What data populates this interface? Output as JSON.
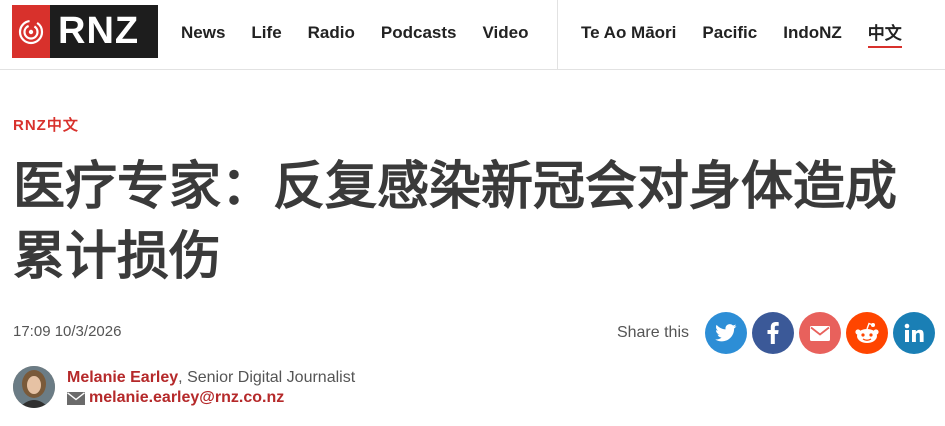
{
  "brand": {
    "name": "RNZ",
    "accent": "#d8312c"
  },
  "nav": {
    "primary": [
      "News",
      "Life",
      "Radio",
      "Podcasts",
      "Video"
    ],
    "secondary": [
      "Te Ao Māori",
      "Pacific",
      "IndoNZ",
      "中文"
    ]
  },
  "article": {
    "section": "RNZ中文",
    "headline": "医疗专家：反复感染新冠会对身体造成累计损伤",
    "timestamp": "17:09 10/3/2026"
  },
  "share": {
    "label": "Share this",
    "buttons": [
      {
        "name": "twitter-icon",
        "color": "#2d8ed6"
      },
      {
        "name": "facebook-icon",
        "color": "#3b5998"
      },
      {
        "name": "email-icon",
        "color": "#e8615c"
      },
      {
        "name": "reddit-icon",
        "color": "#ff4500"
      },
      {
        "name": "linkedin-icon",
        "color": "#1a7fb5"
      }
    ]
  },
  "author": {
    "name": "Melanie Earley",
    "title": ", Senior Digital Journalist",
    "email": "melanie.earley@rnz.co.nz"
  }
}
